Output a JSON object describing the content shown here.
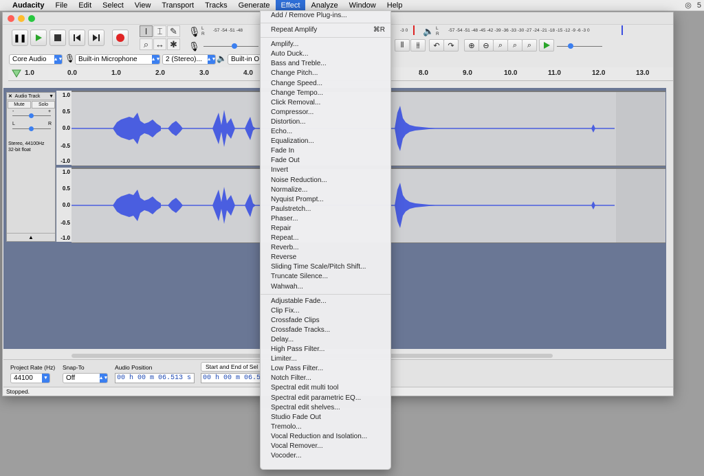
{
  "menubar": {
    "app": "Audacity",
    "items": [
      "File",
      "Edit",
      "Select",
      "View",
      "Transport",
      "Tracks",
      "Generate",
      "Effect",
      "Analyze",
      "Window",
      "Help"
    ],
    "active": "Effect",
    "right_glyph": "5"
  },
  "toolbar": {
    "meter_labels_rec": "-57 -54 -51 -48",
    "meter_labels_rec_tail": "-3 0",
    "meter_labels_play": "-57 -54 -51 -48 -45 -42 -39 -36 -33 -30 -27 -24 -21 -18 -15 -12 -9 -6 -3 0",
    "lr_left": "L",
    "lr_right": "R",
    "host": "Core Audio",
    "input_device": "Built-in Microphone",
    "channels": "2 (Stereo)...",
    "output_device": "Built-in O"
  },
  "ruler": {
    "ticks": [
      "1.0",
      "0.0",
      "1.0",
      "2.0",
      "3.0",
      "4.0",
      "8.0",
      "9.0",
      "10.0",
      "11.0",
      "12.0",
      "13.0"
    ]
  },
  "track": {
    "name": "Audio Track",
    "mute": "Mute",
    "solo": "Solo",
    "gain_minus": "-",
    "gain_plus": "+",
    "pan_left": "L",
    "pan_right": "R",
    "info_line1": "Stereo, 44100Hz",
    "info_line2": "32-bit float",
    "scale": [
      "1.0",
      "0.5",
      "0.0",
      "-0.5",
      "-1.0"
    ]
  },
  "selection_bar": {
    "project_rate_label": "Project Rate (Hz)",
    "project_rate_value": "44100",
    "snap_to_label": "Snap-To",
    "snap_to_value": "Off",
    "audio_position_label": "Audio Position",
    "audio_position_value": "00 h 00 m 06.513 s",
    "start_end_label": "Start and End of Sel",
    "start_value": "00 h 00 m 06.51"
  },
  "status": "Stopped.",
  "effect_menu": {
    "groups": [
      [
        {
          "label": "Add / Remove Plug-ins..."
        }
      ],
      [
        {
          "label": "Repeat Amplify",
          "shortcut": "⌘R"
        }
      ],
      [
        {
          "label": "Amplify..."
        },
        {
          "label": "Auto Duck..."
        },
        {
          "label": "Bass and Treble..."
        },
        {
          "label": "Change Pitch..."
        },
        {
          "label": "Change Speed..."
        },
        {
          "label": "Change Tempo..."
        },
        {
          "label": "Click Removal..."
        },
        {
          "label": "Compressor..."
        },
        {
          "label": "Distortion..."
        },
        {
          "label": "Echo..."
        },
        {
          "label": "Equalization..."
        },
        {
          "label": "Fade In"
        },
        {
          "label": "Fade Out"
        },
        {
          "label": "Invert"
        },
        {
          "label": "Noise Reduction..."
        },
        {
          "label": "Normalize..."
        },
        {
          "label": "Nyquist Prompt..."
        },
        {
          "label": "Paulstretch..."
        },
        {
          "label": "Phaser..."
        },
        {
          "label": "Repair"
        },
        {
          "label": "Repeat..."
        },
        {
          "label": "Reverb..."
        },
        {
          "label": "Reverse"
        },
        {
          "label": "Sliding Time Scale/Pitch Shift..."
        },
        {
          "label": "Truncate Silence..."
        },
        {
          "label": "Wahwah..."
        }
      ],
      [
        {
          "label": "Adjustable Fade..."
        },
        {
          "label": "Clip Fix..."
        },
        {
          "label": "Crossfade Clips"
        },
        {
          "label": "Crossfade Tracks..."
        },
        {
          "label": "Delay..."
        },
        {
          "label": "High Pass Filter..."
        },
        {
          "label": "Limiter..."
        },
        {
          "label": "Low Pass Filter..."
        },
        {
          "label": "Notch Filter..."
        },
        {
          "label": "Spectral edit multi tool"
        },
        {
          "label": "Spectral edit parametric EQ..."
        },
        {
          "label": "Spectral edit shelves..."
        },
        {
          "label": "Studio Fade Out"
        },
        {
          "label": "Tremolo..."
        },
        {
          "label": "Vocal Reduction and Isolation..."
        },
        {
          "label": "Vocal Remover..."
        },
        {
          "label": "Vocoder..."
        }
      ]
    ]
  },
  "colors": {
    "waveform": "#4a5ee0",
    "menu_highlight": "#2f6fd8",
    "record": "#e02424",
    "play": "#2aa52a"
  }
}
